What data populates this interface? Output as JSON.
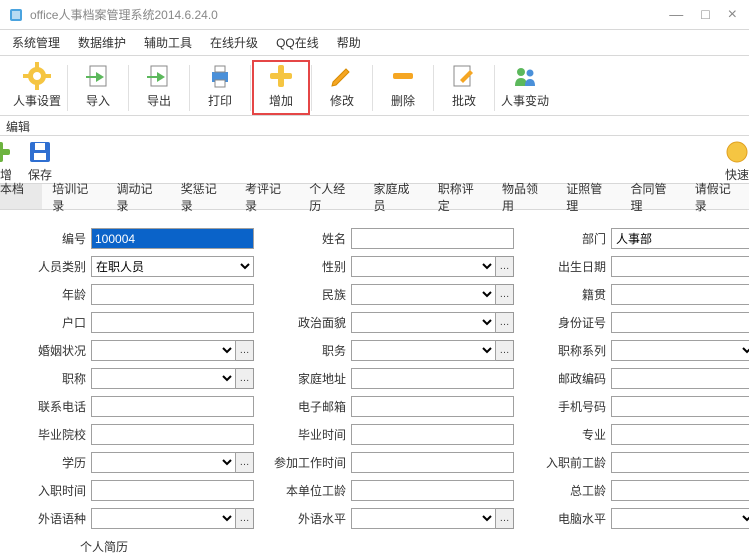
{
  "window": {
    "title": "office人事档案管理系统2014.6.24.0",
    "min": "—",
    "max": "□",
    "close": "×"
  },
  "menu": [
    "系统管理",
    "数据维护",
    "辅助工具",
    "在线升级",
    "QQ在线",
    "帮助"
  ],
  "toolbar": [
    {
      "label": "人事设置",
      "icon": "gear"
    },
    {
      "label": "导入",
      "icon": "import"
    },
    {
      "label": "导出",
      "icon": "export"
    },
    {
      "label": "打印",
      "icon": "print"
    },
    {
      "label": "增加",
      "icon": "plus",
      "highlight": true
    },
    {
      "label": "修改",
      "icon": "edit"
    },
    {
      "label": "删除",
      "icon": "minus"
    },
    {
      "label": "批改",
      "icon": "batch"
    },
    {
      "label": "人事变动",
      "icon": "people"
    }
  ],
  "sub_header": "编辑",
  "toolbar2": {
    "add": "新增",
    "save": "保存",
    "fast": "快速"
  },
  "tabs": [
    "基本档案",
    "培训记录",
    "调动记录",
    "奖惩记录",
    "考评记录",
    "个人经历",
    "家庭成员",
    "职称评定",
    "物品领用",
    "证照管理",
    "合同管理",
    "请假记录"
  ],
  "form": {
    "c1": [
      {
        "label": "编号",
        "value": "100004",
        "type": "text",
        "selected": true,
        "extra": ""
      },
      {
        "label": "人员类别",
        "value": "在职人员",
        "type": "select",
        "extra": ""
      },
      {
        "label": "年龄",
        "value": "",
        "type": "text",
        "extra": ""
      },
      {
        "label": "户口",
        "value": "",
        "type": "text",
        "extra": ""
      },
      {
        "label": "婚姻状况",
        "value": "",
        "type": "select",
        "extra": "dots"
      },
      {
        "label": "职称",
        "value": "",
        "type": "select",
        "extra": "dots"
      },
      {
        "label": "联系电话",
        "value": "",
        "type": "text",
        "extra": ""
      },
      {
        "label": "毕业院校",
        "value": "",
        "type": "text",
        "extra": ""
      },
      {
        "label": "学历",
        "value": "",
        "type": "select",
        "extra": "dots"
      },
      {
        "label": "入职时间",
        "value": "",
        "type": "text",
        "extra": ""
      },
      {
        "label": "外语语种",
        "value": "",
        "type": "select",
        "extra": "dots"
      }
    ],
    "c2": [
      {
        "label": "姓名",
        "value": "",
        "type": "text",
        "extra": ""
      },
      {
        "label": "性别",
        "value": "",
        "type": "select",
        "extra": "dots"
      },
      {
        "label": "民族",
        "value": "",
        "type": "select",
        "extra": "dots"
      },
      {
        "label": "政治面貌",
        "value": "",
        "type": "select",
        "extra": "dots"
      },
      {
        "label": "职务",
        "value": "",
        "type": "select",
        "extra": "dots"
      },
      {
        "label": "家庭地址",
        "value": "",
        "type": "text",
        "extra": ""
      },
      {
        "label": "电子邮箱",
        "value": "",
        "type": "text",
        "extra": ""
      },
      {
        "label": "毕业时间",
        "value": "",
        "type": "text",
        "extra": ""
      },
      {
        "label": "参加工作时间",
        "value": "",
        "type": "text",
        "extra": ""
      },
      {
        "label": "本单位工龄",
        "value": "",
        "type": "text",
        "extra": ""
      },
      {
        "label": "外语水平",
        "value": "",
        "type": "select",
        "extra": "dots"
      }
    ],
    "c3": [
      {
        "label": "部门",
        "value": "人事部",
        "type": "select",
        "extra": ""
      },
      {
        "label": "出生日期",
        "value": "",
        "type": "text",
        "extra": ""
      },
      {
        "label": "籍贯",
        "value": "",
        "type": "text",
        "extra": ""
      },
      {
        "label": "身份证号",
        "value": "",
        "type": "text",
        "extra": ""
      },
      {
        "label": "职称系列",
        "value": "",
        "type": "select",
        "extra": "dots"
      },
      {
        "label": "邮政编码",
        "value": "",
        "type": "text",
        "extra": ""
      },
      {
        "label": "手机号码",
        "value": "",
        "type": "text",
        "extra": ""
      },
      {
        "label": "专业",
        "value": "",
        "type": "text",
        "extra": ""
      },
      {
        "label": "入职前工龄",
        "value": "",
        "type": "text",
        "extra": ""
      },
      {
        "label": "总工龄",
        "value": "",
        "type": "text",
        "extra": ""
      },
      {
        "label": "电脑水平",
        "value": "",
        "type": "select",
        "extra": "dots"
      }
    ]
  },
  "bottom": "个人简历"
}
